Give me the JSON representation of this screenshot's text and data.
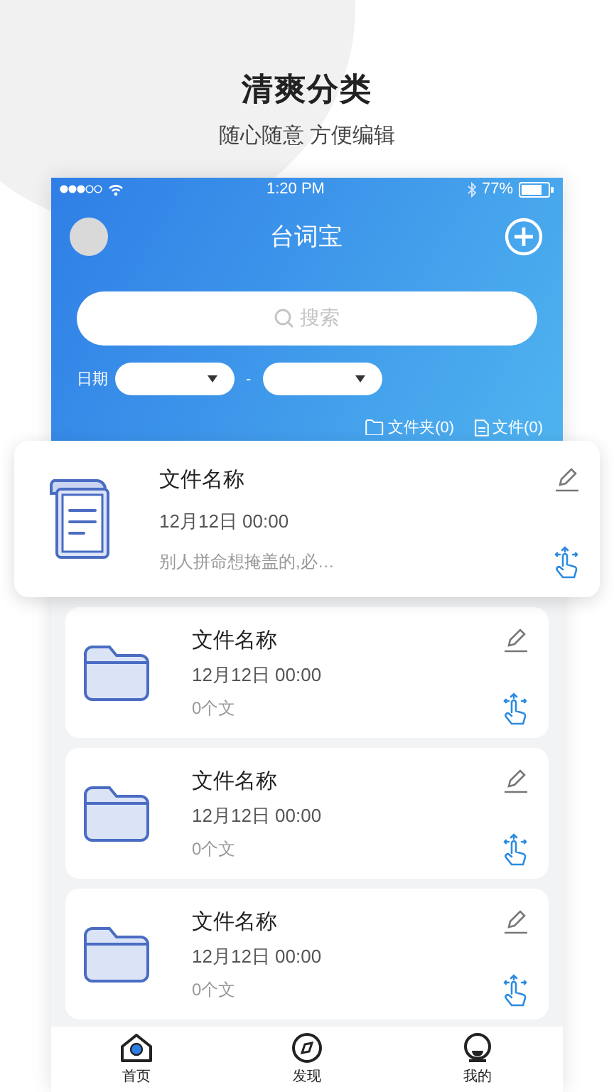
{
  "heading": {
    "title": "清爽分类",
    "subtitle": "随心随意 方便编辑"
  },
  "status_bar": {
    "time": "1:20 PM",
    "battery": "77%"
  },
  "app_bar": {
    "title": "台词宝"
  },
  "search": {
    "placeholder": "搜索"
  },
  "date_filter": {
    "label": "日期",
    "separator": "-"
  },
  "counts": [
    {
      "kind": "folder",
      "label": "文件夹(0)"
    },
    {
      "kind": "file",
      "label": "文件(0)"
    }
  ],
  "items": [
    {
      "kind": "file",
      "raised": true,
      "name": "文件名称",
      "date": "12月12日 00:00",
      "detail": "别人拼命想掩盖的,必…"
    },
    {
      "kind": "folder",
      "raised": false,
      "name": "文件名称",
      "date": "12月12日 00:00",
      "detail": "0个文"
    },
    {
      "kind": "folder",
      "raised": false,
      "name": "文件名称",
      "date": "12月12日 00:00",
      "detail": "0个文"
    },
    {
      "kind": "folder",
      "raised": false,
      "name": "文件名称",
      "date": "12月12日 00:00",
      "detail": "0个文"
    }
  ],
  "tabs": [
    {
      "kind": "home",
      "label": "首页",
      "selected": true
    },
    {
      "kind": "discover",
      "label": "发现",
      "selected": false
    },
    {
      "kind": "profile",
      "label": "我的",
      "selected": false
    }
  ]
}
